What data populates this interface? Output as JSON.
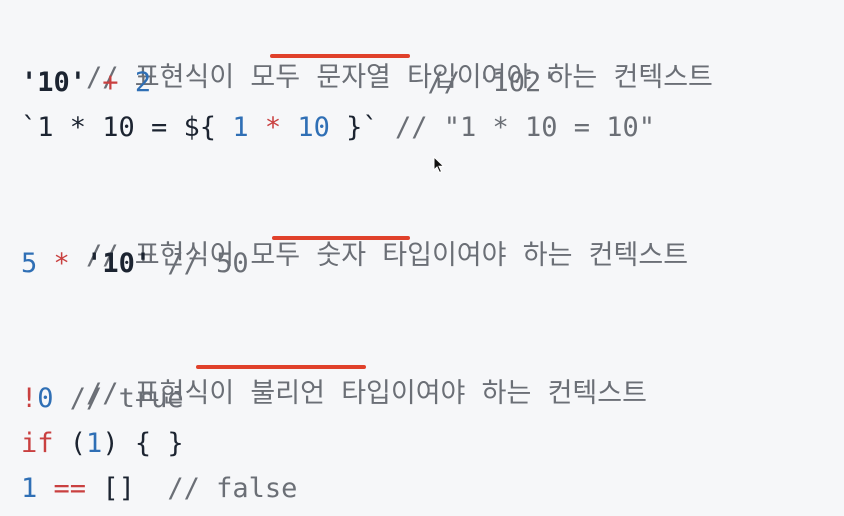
{
  "colors": {
    "background": "#f6f7f9",
    "comment": "#6b6f76",
    "number": "#2f6fb5",
    "operator": "#c94040",
    "string": "#1c2431",
    "highlight": "#e0412b"
  },
  "code": {
    "l1": {
      "comment": "// 표현식이 모두 문자열 타입이여야 하는 컨텍스트"
    },
    "l2": {
      "str": "'10'",
      "sp1": " ",
      "op": "+",
      "sp2": " ",
      "num": "2",
      "pad": "                 ",
      "comment": "// '102'"
    },
    "l3": {
      "tpl_open": "`1 * 10 = ${ ",
      "num1": "1",
      "sp1": " ",
      "op": "*",
      "sp2": " ",
      "num2": "10",
      "tpl_close": " }`",
      "sp3": " ",
      "comment": "// \"1 * 10 = 10\""
    },
    "l5": {
      "comment": "// 표현식이 모두 숫자 타입이여야 하는 컨텍스트"
    },
    "l6": {
      "num": "5",
      "sp1": " ",
      "op": "*",
      "sp2": " ",
      "str": "'10'",
      "sp3": " ",
      "comment": "// 50"
    },
    "l8": {
      "comment": "// 표현식이 불리언 타입이여야 하는 컨텍스트"
    },
    "l9": {
      "op": "!",
      "num": "0",
      "sp": " ",
      "comment": "// true"
    },
    "l10": {
      "kw": "if",
      "sp1": " ",
      "paren_open": "(",
      "num": "1",
      "paren_close": ")",
      "rest": " { }"
    },
    "l11": {
      "num": "1",
      "sp1": " ",
      "op": "==",
      "sp2": " ",
      "arr": "[]",
      "sp3": "  ",
      "comment": "// false"
    }
  }
}
